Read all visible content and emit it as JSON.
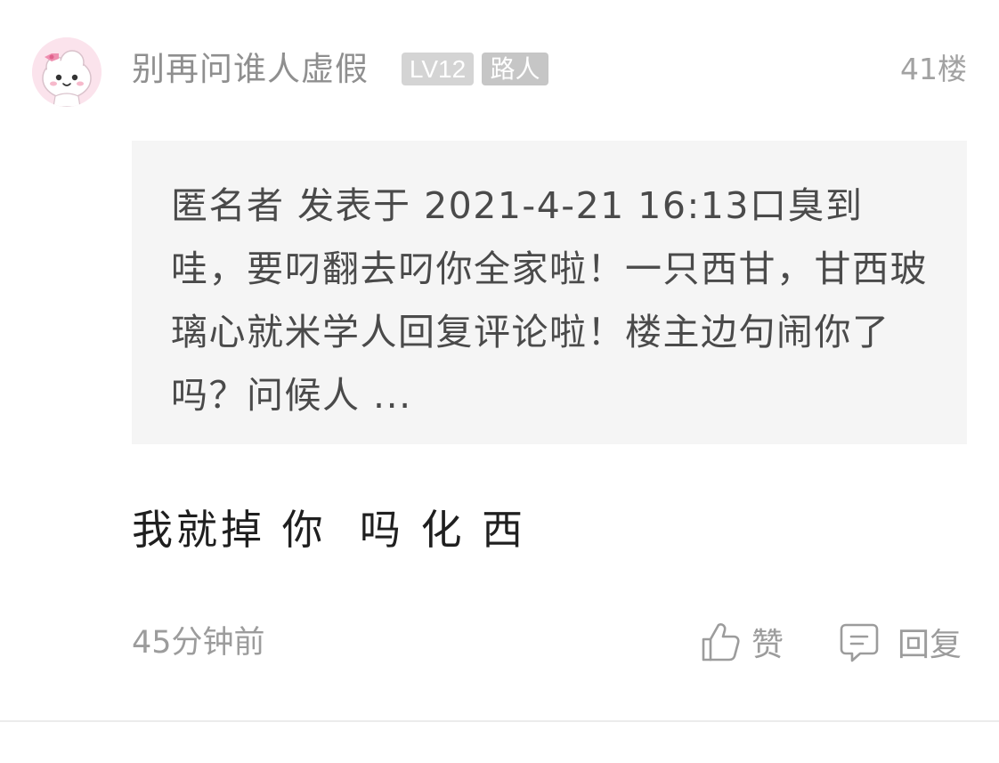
{
  "comment": {
    "username": "别再问谁人虚假",
    "level_badge": "LV12",
    "role_badge": "路人",
    "floor": "41楼",
    "quote_text": "匿名者 发表于 2021-4-21 16:13口臭到哇，要叼翻去叼你全家啦！一只西甘，甘西玻璃心就米学人回复评论啦！楼主边句闹你了吗？问候人 ...",
    "text": "我就掉 你  吗 化 西",
    "time": "45分钟前",
    "like_label": "赞",
    "reply_label": "回复"
  },
  "icons": {
    "avatar": "cartoon-avatar",
    "like": "thumbs-up-icon",
    "reply": "comment-bubble-icon"
  },
  "colors": {
    "username": "#8f8f8f",
    "badge_level_bg": "#d4d4d4",
    "badge_role_bg": "#c6c6c6",
    "quote_bg": "#f5f5f5",
    "comment_text": "#1f1f1f",
    "meta_text": "#9c9c9c"
  }
}
